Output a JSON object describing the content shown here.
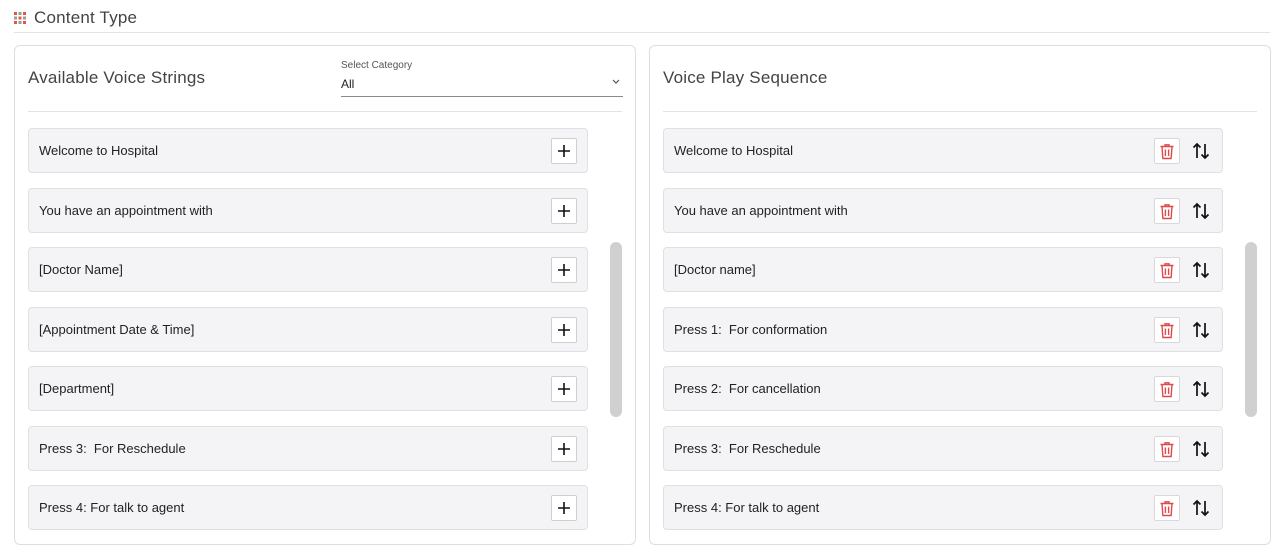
{
  "section": {
    "title": "Content Type",
    "icon": "grid-dots-icon"
  },
  "available": {
    "title": "Available Voice Strings",
    "category": {
      "label": "Select Category",
      "value": "All"
    },
    "items": [
      {
        "label": "Welcome to Hospital"
      },
      {
        "label": "You have an appointment with"
      },
      {
        "label": "[Doctor Name]"
      },
      {
        "label": "[Appointment Date & Time]"
      },
      {
        "label": "[Department]"
      },
      {
        "label": "Press 3:  For Reschedule"
      },
      {
        "label": "Press 4: For talk to agent"
      }
    ]
  },
  "sequence": {
    "title": "Voice Play Sequence",
    "items": [
      {
        "label": "Welcome to Hospital"
      },
      {
        "label": "You have an appointment with"
      },
      {
        "label": "[Doctor name]"
      },
      {
        "label": "Press 1:  For conformation"
      },
      {
        "label": "Press 2:  For cancellation"
      },
      {
        "label": "Press 3:  For Reschedule"
      },
      {
        "label": "Press 4: For talk to agent"
      }
    ]
  },
  "colors": {
    "delete": "#e0494b",
    "item_bg": "#f4f4f6",
    "scrollbar": "#d0d0d0"
  }
}
